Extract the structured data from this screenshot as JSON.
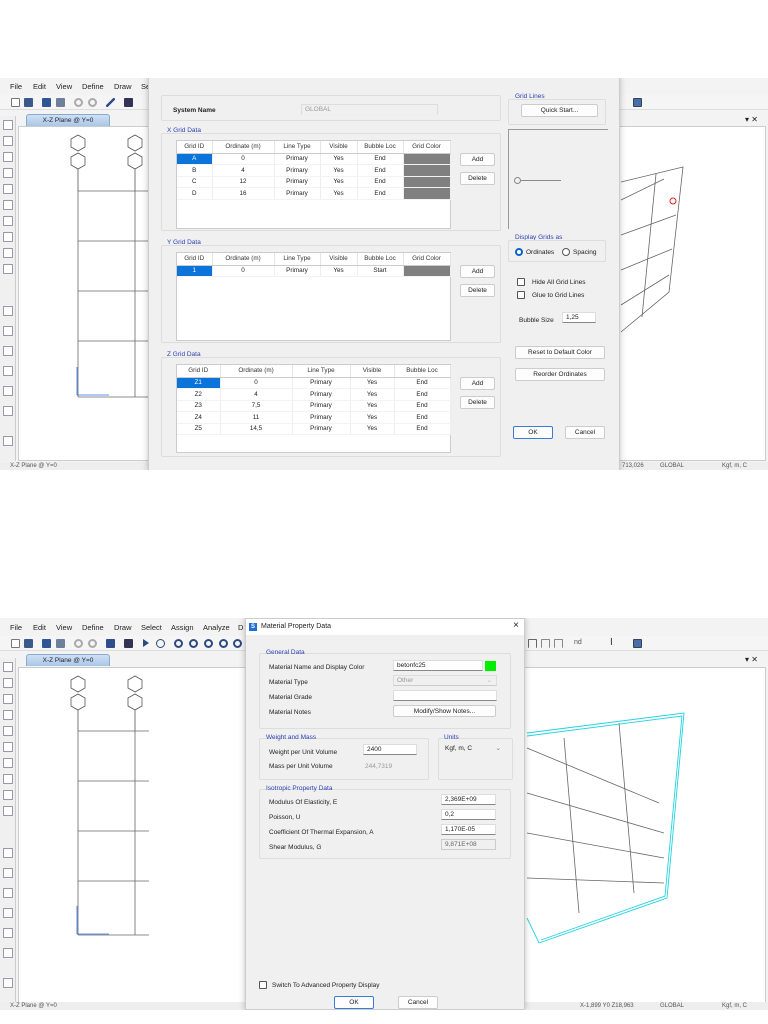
{
  "app": {
    "menu": [
      "File",
      "Edit",
      "View",
      "Define",
      "Draw",
      "Se"
    ],
    "menu_bottom": [
      "File",
      "Edit",
      "View",
      "Define",
      "Draw",
      "Select",
      "Assign",
      "Analyze",
      "D"
    ],
    "view_tab": "X-Z Plane @ Y=0",
    "pane_controls": "▾ ✕",
    "grid_bubbles": {
      "row1": [
        "1",
        "1"
      ],
      "row2": [
        "A",
        "B"
      ]
    },
    "toolbar_right_text": "nd",
    "status_top": {
      "view": "X-Z Plane @ Y=0",
      "coords": "713,026",
      "coord_system": "GLOBAL",
      "units": "Kgf, m, C"
    },
    "status_bottom": {
      "view": "X-Z Plane @ Y=0",
      "coords": "X-1,899  Y0  Z18,963",
      "coord_system": "GLOBAL",
      "units": "Kgf, m, C"
    },
    "colors": {
      "accent": "#0a74da",
      "grid_color": "#808080",
      "material_color": "#00ee00",
      "selection_outline": "#22d3e0"
    }
  },
  "grid_dialog": {
    "system_name_label": "System Name",
    "system_name_value": "GLOBAL",
    "x_grid": {
      "title": "X Grid Data",
      "columns": [
        "Grid ID",
        "Ordinate (m)",
        "Line Type",
        "Visible",
        "Bubble Loc",
        "Grid Color"
      ],
      "rows": [
        [
          "A",
          "0",
          "Primary",
          "Yes",
          "End",
          ""
        ],
        [
          "B",
          "4",
          "Primary",
          "Yes",
          "End",
          ""
        ],
        [
          "C",
          "12",
          "Primary",
          "Yes",
          "End",
          ""
        ],
        [
          "D",
          "16",
          "Primary",
          "Yes",
          "End",
          ""
        ]
      ],
      "add": "Add",
      "delete": "Delete"
    },
    "y_grid": {
      "title": "Y Grid Data",
      "columns": [
        "Grid ID",
        "Ordinate (m)",
        "Line Type",
        "Visible",
        "Bubble Loc",
        "Grid Color"
      ],
      "rows": [
        [
          "1",
          "0",
          "Primary",
          "Yes",
          "Start",
          ""
        ]
      ],
      "add": "Add",
      "delete": "Delete"
    },
    "z_grid": {
      "title": "Z Grid Data",
      "columns": [
        "Grid ID",
        "Ordinate (m)",
        "Line Type",
        "Visible",
        "Bubble Loc"
      ],
      "rows": [
        [
          "Z1",
          "0",
          "Primary",
          "Yes",
          "End"
        ],
        [
          "Z2",
          "4",
          "Primary",
          "Yes",
          "End"
        ],
        [
          "Z3",
          "7,5",
          "Primary",
          "Yes",
          "End"
        ],
        [
          "Z4",
          "11",
          "Primary",
          "Yes",
          "End"
        ],
        [
          "Z5",
          "14,5",
          "Primary",
          "Yes",
          "End"
        ]
      ],
      "add": "Add",
      "delete": "Delete"
    },
    "grid_lines_title": "Grid Lines",
    "quick_start": "Quick Start...",
    "display_grids_title": "Display Grids as",
    "ordinates": "Ordinates",
    "spacing": "Spacing",
    "display_selected": "Ordinates",
    "hide_all": "Hide All Grid Lines",
    "glue": "Glue to Grid Lines",
    "bubble_size_label": "Bubble Size",
    "bubble_size_value": "1,25",
    "reset_color": "Reset to Default Color",
    "reorder": "Reorder Ordinates",
    "ok": "OK",
    "cancel": "Cancel"
  },
  "material_dialog": {
    "title": "Material Property Data",
    "close": "×",
    "general_title": "General Data",
    "name_label": "Material Name and Display Color",
    "name_value": "betonfc25",
    "type_label": "Material Type",
    "type_value": "Other",
    "grade_label": "Material Grade",
    "grade_value": "",
    "notes_label": "Material Notes",
    "notes_button": "Modify/Show Notes...",
    "weight_title": "Weight and Mass",
    "weight_label": "Weight per Unit Volume",
    "weight_value": "2400",
    "mass_label": "Mass per Unit Volume",
    "mass_value": "244,7319",
    "units_title": "Units",
    "units_value": "Kgf, m, C",
    "iso_title": "Isotropic Property Data",
    "e_label": "Modulus Of Elasticity,  E",
    "e_value": "2,369E+09",
    "u_label": "Poisson,  U",
    "u_value": "0,2",
    "a_label": "Coefficient Of Thermal Expansion,  A",
    "a_value": "1,170E-05",
    "g_label": "Shear Modulus,  G",
    "g_value": "9,871E+08",
    "advanced_label": "Switch To Advanced Property Display",
    "ok": "OK",
    "cancel": "Cancel"
  }
}
